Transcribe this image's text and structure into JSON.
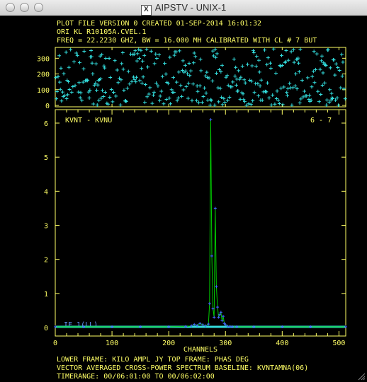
{
  "window": {
    "title": "AIPSTV - UNIX-1"
  },
  "header": {
    "line1": "PLOT FILE VERSION 0  CREATED 01-SEP-2014 16:01:32",
    "line2": "ORI KL   R10105A.CVEL.1",
    "line3": "FREQ = 22.2230 GHZ, BW = 16.000 MH   CALIBRATED WITH CL # 7 BUT"
  },
  "panel": {
    "baseline_label": "KVNT - KVNU",
    "pair_label": "6 - 7",
    "if_label": "IF 1(LL)"
  },
  "footer": {
    "line1": "LOWER FRAME: KILO AMPL JY   TOP FRAME: PHAS DEG",
    "line2": "VECTOR AVERAGED CROSS-POWER SPECTRUM    BASELINE: KVNTAMNA(06)",
    "line3": "TIMERANGE: 00/06:01:00 TO 00/06:02:00"
  },
  "colors": {
    "axes": "#ffff66",
    "phase": "#33dddd",
    "amp_line": "#00cc00",
    "amp_marker": "#4466ff",
    "text": "#ffff66"
  },
  "chart_data": [
    {
      "type": "scatter",
      "title": "",
      "ylabel": "PHAS DEG",
      "ylim": [
        0,
        360
      ],
      "xlim": [
        0,
        512
      ],
      "yticks": [
        0,
        100,
        200,
        300
      ],
      "series": [
        {
          "name": "PHAS DEG",
          "points": [
            [
              0,
              0
            ]
          ]
        }
      ]
    },
    {
      "type": "line",
      "xlabel": "CHANNELS",
      "ylabel": "KILO AMPL JY",
      "xlim": [
        0,
        512
      ],
      "ylim": [
        0,
        6.2
      ],
      "xticks": [
        0,
        100,
        200,
        300,
        400,
        500
      ],
      "yticks": [
        0,
        1,
        2,
        3,
        4,
        5,
        6
      ],
      "series": [
        {
          "name": "KILO AMPL JY",
          "x": [
            0,
            50,
            100,
            150,
            200,
            230,
            240,
            245,
            250,
            255,
            260,
            265,
            270,
            272,
            274,
            276,
            278,
            280,
            282,
            284,
            286,
            288,
            290,
            292,
            294,
            296,
            298,
            300,
            304,
            308,
            312,
            320,
            350,
            400,
            450,
            512
          ],
          "y": [
            0.02,
            0.02,
            0.02,
            0.02,
            0.02,
            0.03,
            0.05,
            0.09,
            0.06,
            0.12,
            0.08,
            0.05,
            0.1,
            0.7,
            6.1,
            2.1,
            0.55,
            0.3,
            3.5,
            1.2,
            0.6,
            0.3,
            0.38,
            0.45,
            0.2,
            0.33,
            0.12,
            0.08,
            0.04,
            0.03,
            0.02,
            0.02,
            0.02,
            0.02,
            0.02,
            0.02
          ]
        }
      ]
    }
  ]
}
